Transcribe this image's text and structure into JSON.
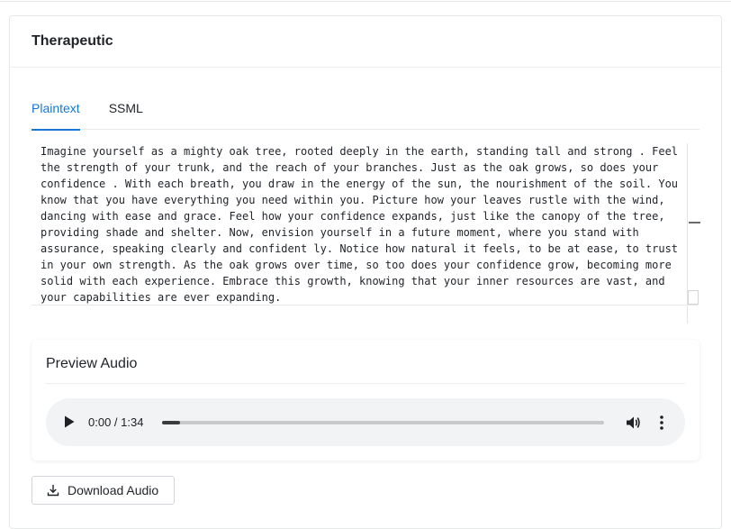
{
  "card": {
    "title": "Therapeutic"
  },
  "tabs": [
    {
      "label": "Plaintext",
      "active": true
    },
    {
      "label": "SSML",
      "active": false
    }
  ],
  "editor": {
    "lines": [
      "Imagine yourself as a mighty oak tree, rooted deeply in the earth, standing tall and strong . Feel",
      "the strength of your trunk, and the reach of your branches. Just as the oak grows, so does your",
      "confidence . With each breath, you draw in the energy of the sun, the nourishment of the soil. You",
      "know that you have everything you need within you. Picture how your leaves rustle with the wind,",
      "dancing with ease and grace. Feel how your confidence expands, just like the canopy of the tree,",
      "providing shade and shelter. Now, envision yourself in a future moment, where you stand with",
      "assurance, speaking clearly and confident ly. Notice how natural it feels, to be at ease, to trust",
      "in your own strength. As the oak grows over time, so too does your confidence grow, becoming more",
      "solid with each experience. Embrace this growth, knowing that your inner resources are vast, and",
      "your capabilities are ever expanding."
    ]
  },
  "preview": {
    "title": "Preview Audio",
    "player": {
      "time": "0:00 / 1:34",
      "progress_fraction": 0.04
    }
  },
  "download": {
    "label": "Download Audio"
  },
  "colors": {
    "accent": "#1677d9",
    "player_bg": "#f1f3f4"
  },
  "icons": {
    "play": "play-icon",
    "volume": "volume-icon",
    "menu": "more-vert-icon",
    "download": "download-icon"
  }
}
